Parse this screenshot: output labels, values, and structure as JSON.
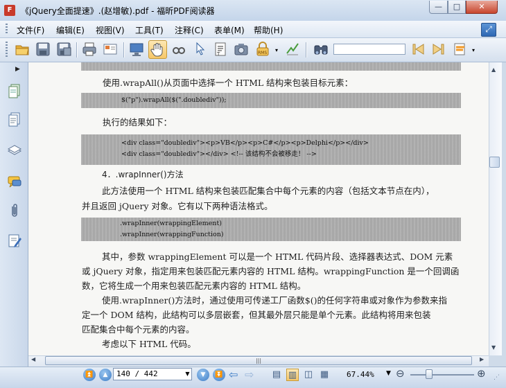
{
  "window": {
    "title": "《jQuery全面提速》.(赵增敏).pdf - 福昕PDF阅读器",
    "minimize": "—",
    "maximize": "□",
    "close": "✕",
    "app_icon": "F"
  },
  "menu": {
    "items": [
      "文件(F)",
      "编辑(E)",
      "视图(V)",
      "工具(T)",
      "注释(C)",
      "表单(M)",
      "帮助(H)"
    ],
    "restore_icon": "⤢"
  },
  "toolbar": {
    "search_value": "",
    "icons": [
      "open-folder-icon",
      "save-icon",
      "save-as-icon",
      "print-icon",
      "email-icon",
      "fullscreen-icon",
      "hand-tool-icon",
      "magnifier-icon",
      "select-arrow-icon",
      "text-select-icon",
      "snapshot-icon",
      "rms-lock-icon",
      "sign-icon",
      "find-binoculars-icon",
      "find-prev-icon",
      "find-next-icon",
      "highlight-icon"
    ]
  },
  "document": {
    "p1": "使用.wrapAll()从页面中选择一个 HTML 结构来包装目标元素：",
    "code1": "$(\"p\").wrapAll($(\".doublediv\"));",
    "p2": "执行的结果如下：",
    "code2_line1": "<div class=\"doublediv\"><p>VB</p><p>C#</p><p>Delphi</p></div>",
    "code2_line2": "<div class=\"doublediv\"></div>     <!--  该结构不会被移走！  -->",
    "heading": "4．.wrapInner()方法",
    "p3_line1": "此方法使用一个 HTML 结构来包装匹配集合中每个元素的内容（包括文本节点在内），",
    "p3_line2": "并且返回 jQuery 对象。它有以下两种语法格式。",
    "code3_line1": ".wrapInner(wrappingElement)",
    "code3_line2": ".wrapInner(wrappingFunction)",
    "p4_line1": "其中，参数 wrappingElement 可以是一个 HTML 代码片段、选择器表达式、DOM 元素",
    "p4_line2": "或 jQuery 对象，指定用来包装匹配元素内容的 HTML 结构。wrappingFunction 是一个回调函",
    "p4_line3": "数，它将生成一个用来包装匹配元素内容的 HTML 结构。",
    "p5_line1": "使用.wrapInner()方法时，通过使用可传递工厂函数$()的任何字符串或对象作为参数来指",
    "p5_line2": "定一个 DOM 结构，此结构可以多层嵌套，但其最外层只能是单个元素。此结构将用来包装",
    "p5_line3": "匹配集合中每个元素的内容。",
    "p6": "考虑以下 HTML 代码。"
  },
  "statusbar": {
    "page_value": "140 / 442",
    "zoom": "67.44%"
  },
  "colors": {
    "accent": "#3c7cc6",
    "active_tool": "#f7c767"
  }
}
